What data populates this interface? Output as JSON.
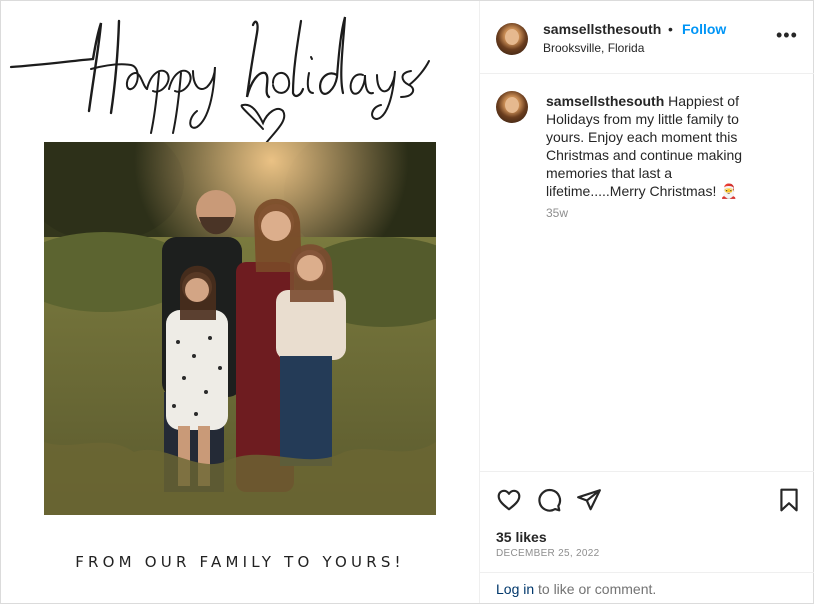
{
  "post_image": {
    "script_text": "Happy holidays",
    "tagline": "FROM OUR FAMILY TO YOURS!"
  },
  "header": {
    "username": "samsellsthesouth",
    "separator": "•",
    "follow_label": "Follow",
    "location": "Brooksville, Florida",
    "more_icon": "more-horizontal-icon",
    "more_glyph": "•••"
  },
  "caption": {
    "username": "samsellsthesouth",
    "text": " Happiest of Holidays from my little family to yours. Enjoy each moment this Christmas and continue making memories that last a lifetime.....Merry Christmas! 🎅",
    "time": "35w"
  },
  "actions": {
    "icons": [
      "heart-icon",
      "comment-icon",
      "share-icon",
      "bookmark-icon"
    ],
    "likes": "35 likes",
    "date": "DECEMBER 25, 2022"
  },
  "login": {
    "link": "Log in",
    "text": " to like or comment."
  },
  "colors": {
    "follow": "#0095f6",
    "link": "#00376b",
    "muted": "#8e8e8e"
  }
}
